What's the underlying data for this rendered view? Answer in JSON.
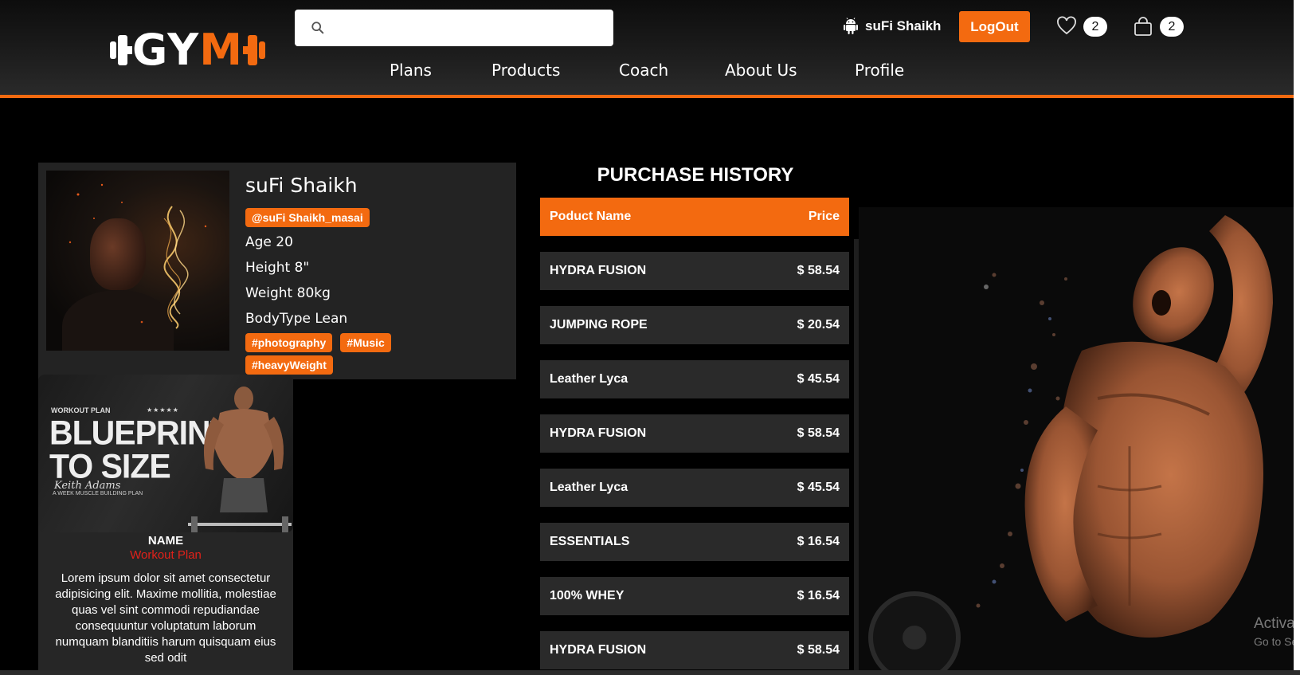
{
  "brand": {
    "logo_text_white": "GY",
    "logo_text_accent": "M",
    "accent_color": "#f36a10"
  },
  "search": {
    "placeholder": "",
    "value": ""
  },
  "user": {
    "name": "suFi Shaikh"
  },
  "header": {
    "logout_label": "LogOut",
    "wishlist_count": "2",
    "cart_count": "2"
  },
  "nav": {
    "items": [
      "Plans",
      "Products",
      "Coach",
      "About Us",
      "Profile"
    ]
  },
  "profile": {
    "name": "suFi Shaikh",
    "handle": "@suFi Shaikh_masai",
    "age": "Age 20",
    "height": "Height 8\"",
    "weight": "Weight 80kg",
    "body_type": "BodyType Lean",
    "hashtags": [
      "#photography",
      "#Music",
      "#heavyWeight"
    ]
  },
  "plan": {
    "image_small": "WORKOUT PLAN",
    "image_stars": "★★★★★",
    "image_title_1": "BLUEPRINT",
    "image_title_2": "TO SIZE",
    "image_author": "Keith Adams",
    "image_sub": "A WEEK MUSCLE BUILDING PLAN",
    "name": "NAME",
    "type": "Workout Plan",
    "description": "Lorem ipsum dolor sit amet consectetur adipisicing elit. Maxime mollitia, molestiae quas vel sint commodi repudiandae consequuntur voluptatum laborum numquam blanditiis harum quisquam eius sed odit"
  },
  "purchase_history": {
    "title": "PURCHASE HISTORY",
    "columns": [
      "Poduct Name",
      "Price"
    ],
    "rows": [
      {
        "name": "HYDRA FUSION",
        "price": "$ 58.54"
      },
      {
        "name": "JUMPING ROPE",
        "price": "$ 20.54"
      },
      {
        "name": "Leather Lyca",
        "price": "$ 45.54"
      },
      {
        "name": "HYDRA FUSION",
        "price": "$ 58.54"
      },
      {
        "name": "Leather Lyca",
        "price": "$ 45.54"
      },
      {
        "name": "ESSENTIALS",
        "price": "$ 16.54"
      },
      {
        "name": "100% WHEY",
        "price": "$ 16.54"
      },
      {
        "name": "HYDRA FUSION",
        "price": "$ 58.54"
      }
    ]
  },
  "watermark": {
    "line1": "Activa",
    "line2": "Go to Se"
  }
}
